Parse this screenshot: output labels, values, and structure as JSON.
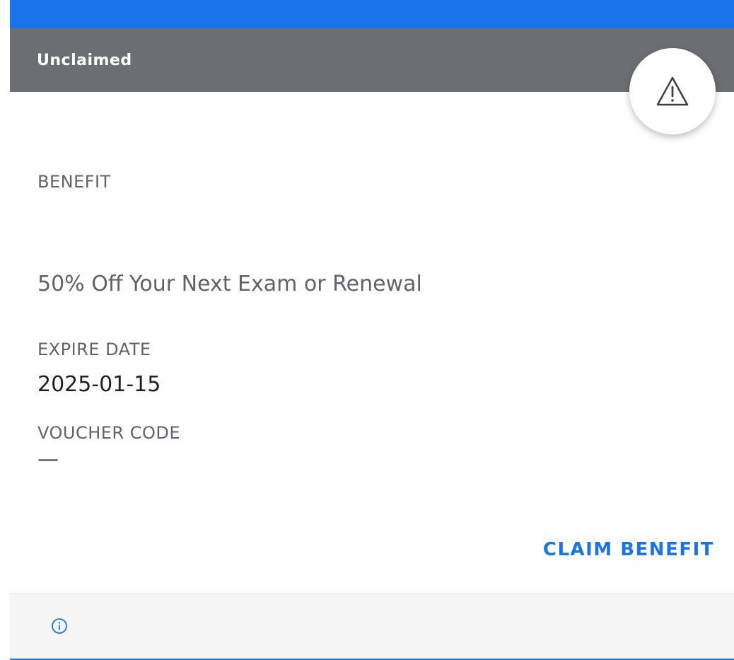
{
  "header": {
    "status": "Unclaimed"
  },
  "icons": {
    "status_icon": "warning-icon",
    "footer_icon": "info-icon"
  },
  "fields": {
    "benefit_label": "BENEFIT",
    "benefit_value": "50% Off Your Next Exam or Renewal",
    "expire_label": "EXPIRE DATE",
    "expire_value": "2025-01-15",
    "voucher_label": "VOUCHER CODE",
    "voucher_value": "—"
  },
  "actions": {
    "claim_label": "CLAIM BENEFIT"
  },
  "colors": {
    "accent": "#1a73e8",
    "header_bg": "#6b6e72",
    "footer_bg": "#f5f5f5"
  }
}
